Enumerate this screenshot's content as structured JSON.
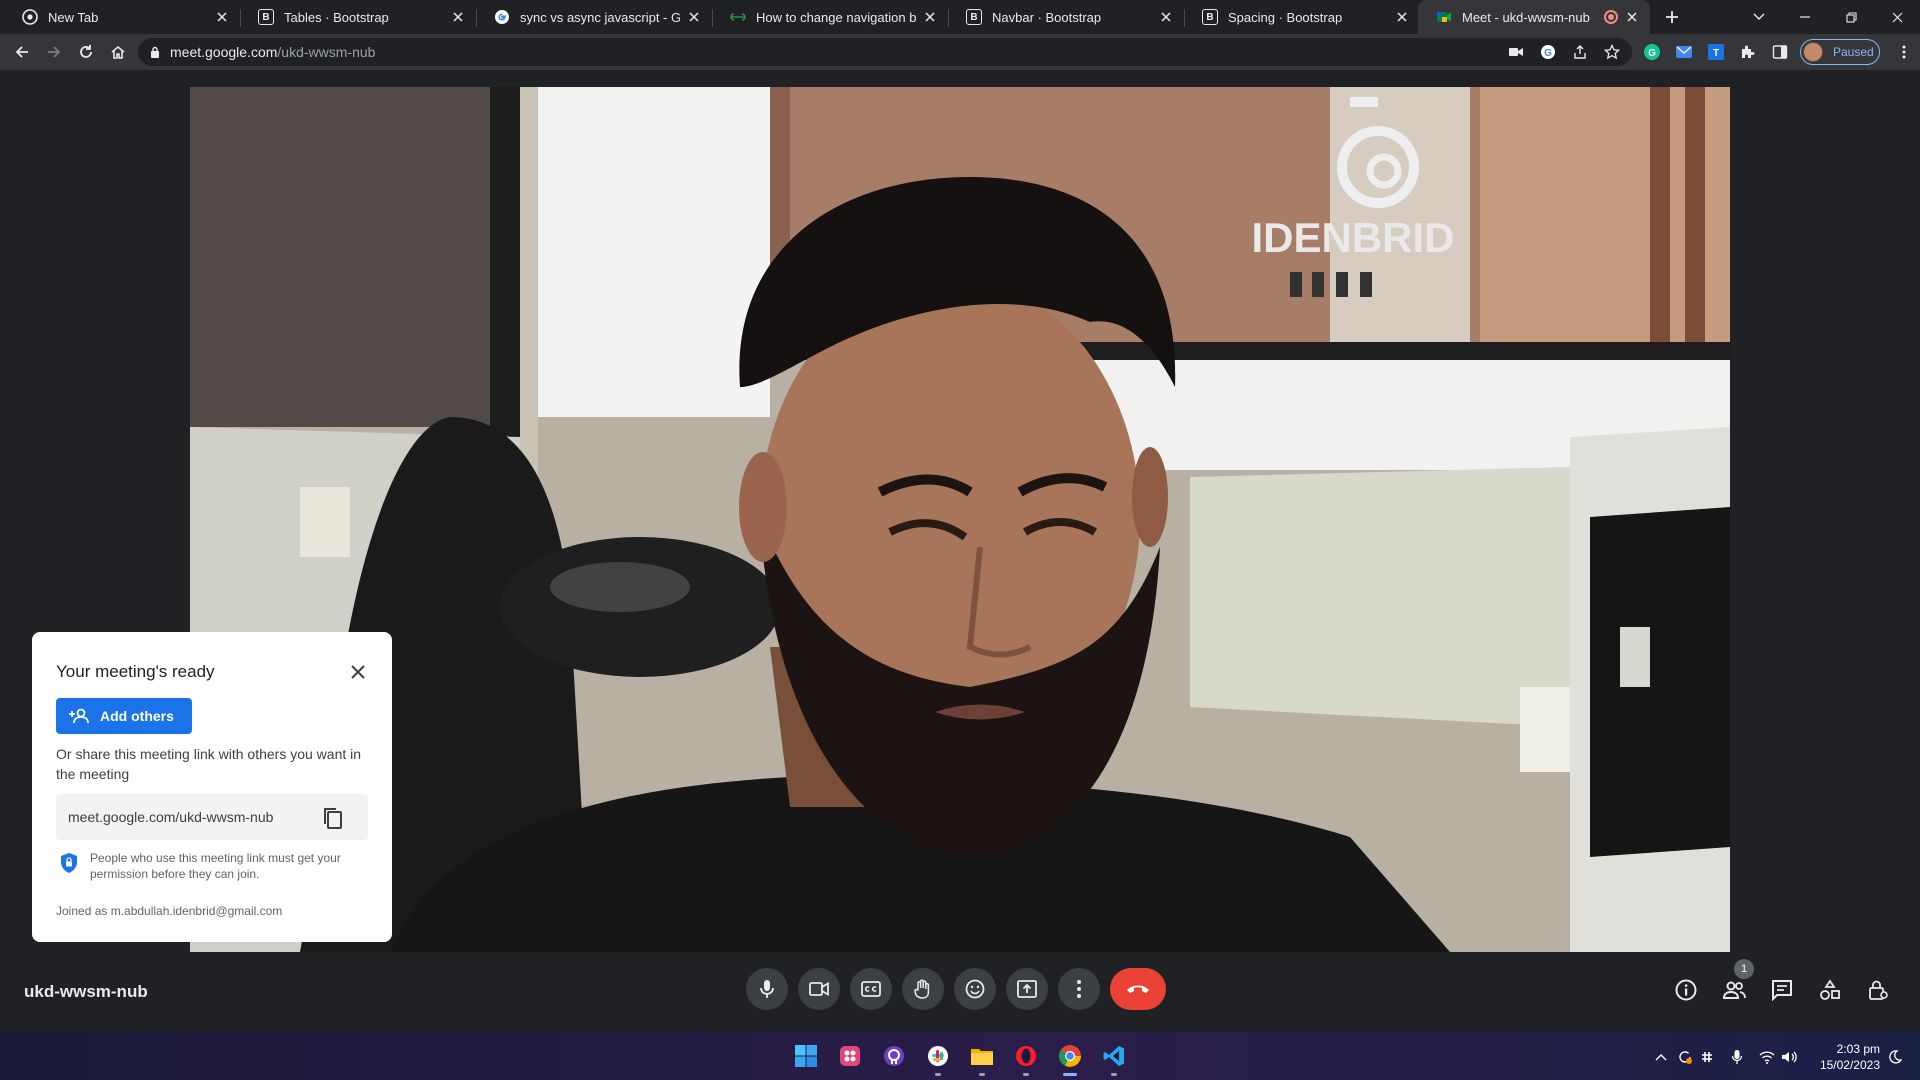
{
  "browser": {
    "tabs": [
      {
        "title": "New Tab",
        "favicon": "chrome-icon",
        "active": false
      },
      {
        "title": "Tables · Bootstrap",
        "favicon": "bootstrap-icon",
        "active": false
      },
      {
        "title": "sync vs async javascript - Googl",
        "favicon": "google-icon",
        "active": false
      },
      {
        "title": "How to change navigation bar c",
        "favicon": "geeksforgeeks-icon",
        "active": false
      },
      {
        "title": "Navbar · Bootstrap",
        "favicon": "bootstrap-icon",
        "active": false
      },
      {
        "title": "Spacing · Bootstrap",
        "favicon": "bootstrap-icon",
        "active": false
      },
      {
        "title": "Meet - ukd-wwsm-nub",
        "favicon": "google-meet-icon",
        "active": true,
        "recording": true
      }
    ],
    "url_host": "meet.google.com",
    "url_path": "/ukd-wwsm-nub",
    "profile_status": "Paused"
  },
  "meet": {
    "meeting_code": "ukd-wwsm-nub",
    "participant_count": "1",
    "card": {
      "title": "Your meeting's ready",
      "add_others_label": "Add others",
      "share_text": "Or share this meeting link with others you want in the meeting",
      "link": "meet.google.com/ukd-wwsm-nub",
      "permission_note": "People who use this meeting link must get your permission before they can join.",
      "joined_as": "Joined as m.abdullah.idenbrid@gmail.com"
    },
    "video_sign_text": "IDENBRID"
  },
  "taskbar": {
    "time": "2:03 pm",
    "date": "15/02/2023"
  },
  "colors": {
    "accent": "#1a73e8",
    "end_call": "#ea4335",
    "meet_bg": "#202124",
    "control_bg": "#3c4043"
  }
}
